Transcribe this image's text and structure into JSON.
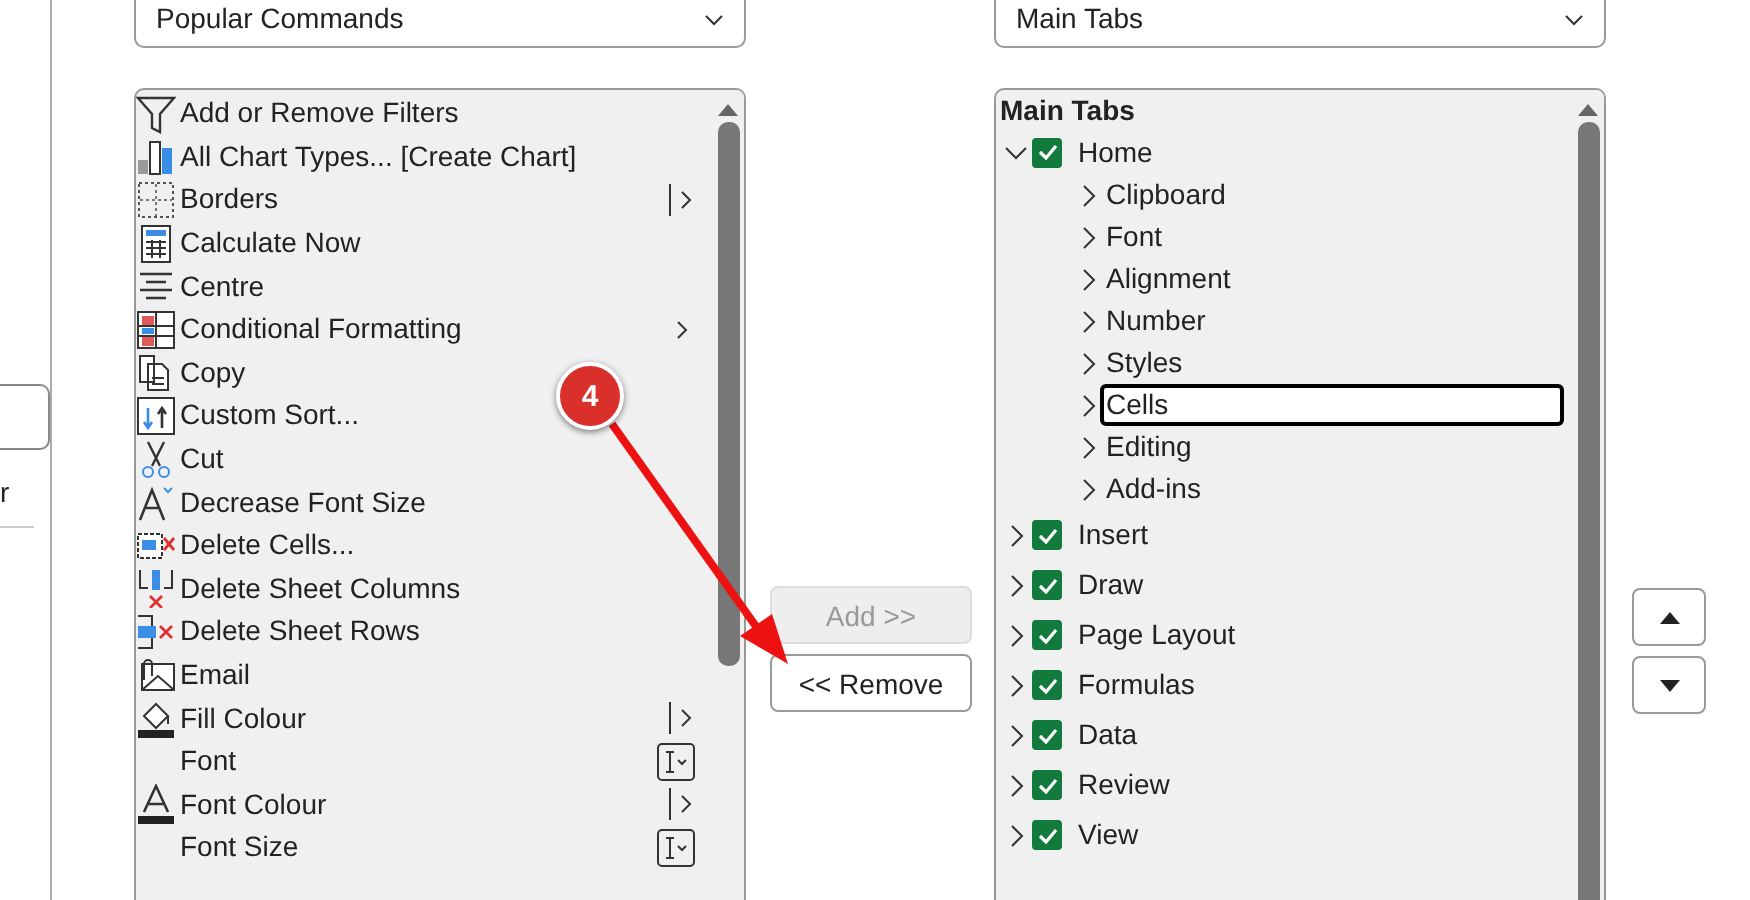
{
  "side_panel": {
    "label": "r"
  },
  "commands": {
    "source": "Popular Commands",
    "items": [
      {
        "label": "Add or Remove Filters",
        "kind": "plain"
      },
      {
        "label": "All Chart Types... [Create Chart]",
        "kind": "plain"
      },
      {
        "label": "Borders",
        "kind": "split"
      },
      {
        "label": "Calculate Now",
        "kind": "plain"
      },
      {
        "label": "Centre",
        "kind": "plain"
      },
      {
        "label": "Conditional Formatting",
        "kind": "submenu"
      },
      {
        "label": "Copy",
        "kind": "plain"
      },
      {
        "label": "Custom Sort...",
        "kind": "plain"
      },
      {
        "label": "Cut",
        "kind": "plain"
      },
      {
        "label": "Decrease Font Size",
        "kind": "plain"
      },
      {
        "label": "Delete Cells...",
        "kind": "plain"
      },
      {
        "label": "Delete Sheet Columns",
        "kind": "plain"
      },
      {
        "label": "Delete Sheet Rows",
        "kind": "plain"
      },
      {
        "label": "Email",
        "kind": "plain"
      },
      {
        "label": "Fill Colour",
        "kind": "split"
      },
      {
        "label": "Font",
        "kind": "combo"
      },
      {
        "label": "Font Colour",
        "kind": "split"
      },
      {
        "label": "Font Size",
        "kind": "combo"
      }
    ]
  },
  "buttons": [
    {
      "label": "Add >>",
      "disabled": true
    },
    {
      "label": "<< Remove",
      "disabled": false
    }
  ],
  "ribbon": {
    "source": "Main Tabs",
    "header": "Main Tabs",
    "tabs": [
      {
        "label": "Home",
        "checked": true,
        "expanded": true,
        "selected": false,
        "children": [
          {
            "label": "Clipboard",
            "selected": false
          },
          {
            "label": "Font",
            "selected": false
          },
          {
            "label": "Alignment",
            "selected": false
          },
          {
            "label": "Number",
            "selected": false
          },
          {
            "label": "Styles",
            "selected": false
          },
          {
            "label": "Cells",
            "selected": true
          },
          {
            "label": "Editing",
            "selected": false
          },
          {
            "label": "Add-ins",
            "selected": false
          }
        ]
      },
      {
        "label": "Insert",
        "checked": true,
        "expanded": false,
        "selected": false
      },
      {
        "label": "Draw",
        "checked": true,
        "expanded": false,
        "selected": false
      },
      {
        "label": "Page Layout",
        "checked": true,
        "expanded": false,
        "selected": false
      },
      {
        "label": "Formulas",
        "checked": true,
        "expanded": false,
        "selected": false
      },
      {
        "label": "Data",
        "checked": true,
        "expanded": false,
        "selected": false
      },
      {
        "label": "Review",
        "checked": true,
        "expanded": false,
        "selected": false
      },
      {
        "label": "View",
        "checked": true,
        "expanded": false,
        "selected": false
      }
    ]
  },
  "annotation": {
    "step": "4"
  }
}
